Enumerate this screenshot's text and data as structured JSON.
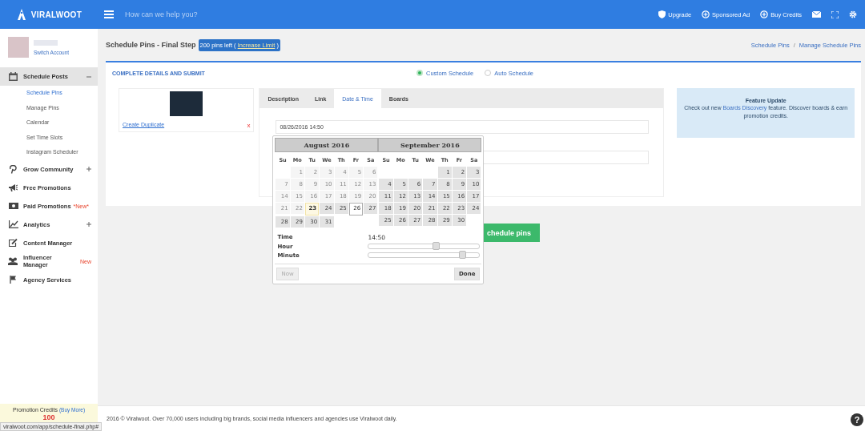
{
  "topbar": {
    "logo": "VIRALWOOT",
    "search": {
      "placeholder": "How can we help you?"
    },
    "actions": [
      {
        "label": "Upgrade",
        "kind": "shield"
      },
      {
        "label": "Sponsored Ad",
        "kind": "plus"
      },
      {
        "label": "Buy Credits",
        "kind": "plus"
      }
    ]
  },
  "profile": {
    "switch_label": "Switch Account"
  },
  "sidebar": {
    "items": [
      {
        "label": "Schedule Posts",
        "kind": "calendar",
        "expanded": true,
        "children": [
          {
            "label": "Schedule Pins",
            "selected": true
          },
          {
            "label": "Manage Pins",
            "selected": false
          },
          {
            "label": "Calendar",
            "selected": false
          },
          {
            "label": "Set Time Slots",
            "selected": false
          },
          {
            "label": "Instagram Scheduler",
            "selected": false
          }
        ]
      },
      {
        "label": "Grow Community",
        "kind": "pin",
        "expanded": false
      },
      {
        "label": "Free Promotions",
        "kind": "megaphone"
      },
      {
        "label": "Paid Promotions",
        "kind": "money",
        "badge": "*New*"
      },
      {
        "label": "Analytics",
        "kind": "chart",
        "expanded": false
      },
      {
        "label": "Content Manager",
        "kind": "edit"
      },
      {
        "label": "Influencer Manager",
        "kind": "users",
        "badge": "New"
      },
      {
        "label": "Agency Services",
        "kind": "flag"
      }
    ],
    "credits": {
      "label": "Promotion Credits",
      "link": "(Buy More)",
      "value": "100"
    }
  },
  "page": {
    "title": "Schedule Pins - Final Step",
    "limit": {
      "text": "200 pins left (",
      "link": "Increase Limit",
      "close": ")"
    },
    "breadcrumbs": [
      "Schedule Pins",
      "Manage Schedule Pins"
    ],
    "breadcrumb_separator": "/"
  },
  "form": {
    "heading": "COMPLETE DETAILS AND SUBMIT",
    "schedule_options": [
      {
        "label": "Custom Schedule",
        "selected": true
      },
      {
        "label": "Auto Schedule",
        "selected": false
      }
    ],
    "pin": {
      "duplicate_link": "Create Duplicate",
      "remove": "x"
    },
    "tabs": [
      {
        "label": "Description",
        "selected": false
      },
      {
        "label": "Link",
        "selected": false
      },
      {
        "label": "Date & Time",
        "selected": true
      },
      {
        "label": "Boards",
        "selected": false
      }
    ],
    "datetime_value": "08/26/2016 14:50",
    "submit": "chedule pins"
  },
  "datepicker": {
    "months": [
      {
        "title": "August 2016",
        "weekdays": [
          "Su",
          "Mo",
          "Tu",
          "We",
          "Th",
          "Fr",
          "Sa"
        ],
        "weeks": [
          [
            {
              "kind": "blank"
            },
            {
              "n": "1",
              "kind": "past"
            },
            {
              "n": "2",
              "kind": "past"
            },
            {
              "n": "3",
              "kind": "past"
            },
            {
              "n": "4",
              "kind": "past"
            },
            {
              "n": "5",
              "kind": "past"
            },
            {
              "n": "6",
              "kind": "past"
            }
          ],
          [
            {
              "n": "7",
              "kind": "past"
            },
            {
              "n": "8",
              "kind": "past"
            },
            {
              "n": "9",
              "kind": "past"
            },
            {
              "n": "10",
              "kind": "past"
            },
            {
              "n": "11",
              "kind": "past"
            },
            {
              "n": "12",
              "kind": "past"
            },
            {
              "n": "13",
              "kind": "past"
            }
          ],
          [
            {
              "n": "14",
              "kind": "past"
            },
            {
              "n": "15",
              "kind": "past"
            },
            {
              "n": "16",
              "kind": "past"
            },
            {
              "n": "17",
              "kind": "past"
            },
            {
              "n": "18",
              "kind": "past"
            },
            {
              "n": "19",
              "kind": "past"
            },
            {
              "n": "20",
              "kind": "past"
            }
          ],
          [
            {
              "n": "21",
              "kind": "past"
            },
            {
              "n": "22",
              "kind": "past"
            },
            {
              "n": "23",
              "kind": "today"
            },
            {
              "n": "24",
              "kind": "open"
            },
            {
              "n": "25",
              "kind": "open"
            },
            {
              "n": "26",
              "kind": "selected"
            },
            {
              "n": "27",
              "kind": "open"
            }
          ],
          [
            {
              "n": "28",
              "kind": "open"
            },
            {
              "n": "29",
              "kind": "open"
            },
            {
              "n": "30",
              "kind": "open"
            },
            {
              "n": "31",
              "kind": "open"
            }
          ]
        ]
      },
      {
        "title": "September 2016",
        "weekdays": [
          "Su",
          "Mo",
          "Tu",
          "We",
          "Th",
          "Fr",
          "Sa"
        ],
        "weeks": [
          [
            {
              "kind": "blank"
            },
            {
              "kind": "blank"
            },
            {
              "kind": "blank"
            },
            {
              "kind": "blank"
            },
            {
              "n": "1",
              "kind": "open"
            },
            {
              "n": "2",
              "kind": "open"
            },
            {
              "n": "3",
              "kind": "open"
            }
          ],
          [
            {
              "n": "4",
              "kind": "open"
            },
            {
              "n": "5",
              "kind": "open"
            },
            {
              "n": "6",
              "kind": "open"
            },
            {
              "n": "7",
              "kind": "open"
            },
            {
              "n": "8",
              "kind": "open"
            },
            {
              "n": "9",
              "kind": "open"
            },
            {
              "n": "10",
              "kind": "open"
            }
          ],
          [
            {
              "n": "11",
              "kind": "open"
            },
            {
              "n": "12",
              "kind": "open"
            },
            {
              "n": "13",
              "kind": "open"
            },
            {
              "n": "14",
              "kind": "open"
            },
            {
              "n": "15",
              "kind": "open"
            },
            {
              "n": "16",
              "kind": "open"
            },
            {
              "n": "17",
              "kind": "open"
            }
          ],
          [
            {
              "n": "18",
              "kind": "open"
            },
            {
              "n": "19",
              "kind": "open"
            },
            {
              "n": "20",
              "kind": "open"
            },
            {
              "n": "21",
              "kind": "open"
            },
            {
              "n": "22",
              "kind": "open"
            },
            {
              "n": "23",
              "kind": "open"
            },
            {
              "n": "24",
              "kind": "open"
            }
          ],
          [
            {
              "n": "25",
              "kind": "open"
            },
            {
              "n": "26",
              "kind": "open"
            },
            {
              "n": "27",
              "kind": "open"
            },
            {
              "n": "28",
              "kind": "open"
            },
            {
              "n": "29",
              "kind": "open"
            },
            {
              "n": "30",
              "kind": "open"
            }
          ]
        ]
      }
    ],
    "time_label": "Time",
    "time_value": "14:50",
    "sliders": [
      {
        "label": "Hour",
        "level": 0.61
      },
      {
        "label": "Minute",
        "level": 0.85
      }
    ],
    "buttons": [
      {
        "label": "Now",
        "disabled": true
      },
      {
        "label": "Done",
        "disabled": false
      }
    ]
  },
  "feature_update": {
    "title": "Feature Update",
    "text_before": "Check out new ",
    "link": "Boards Discovery",
    "text_after": " feature. Discover boards & earn promotion credits."
  },
  "footer": "2016 © Viralwoot. Over 70,000 users including big brands, social media influencers and agencies use Viralwoot daily.",
  "status_bar": "viralwoot.com/app/schedule-final.php#",
  "help": "?"
}
